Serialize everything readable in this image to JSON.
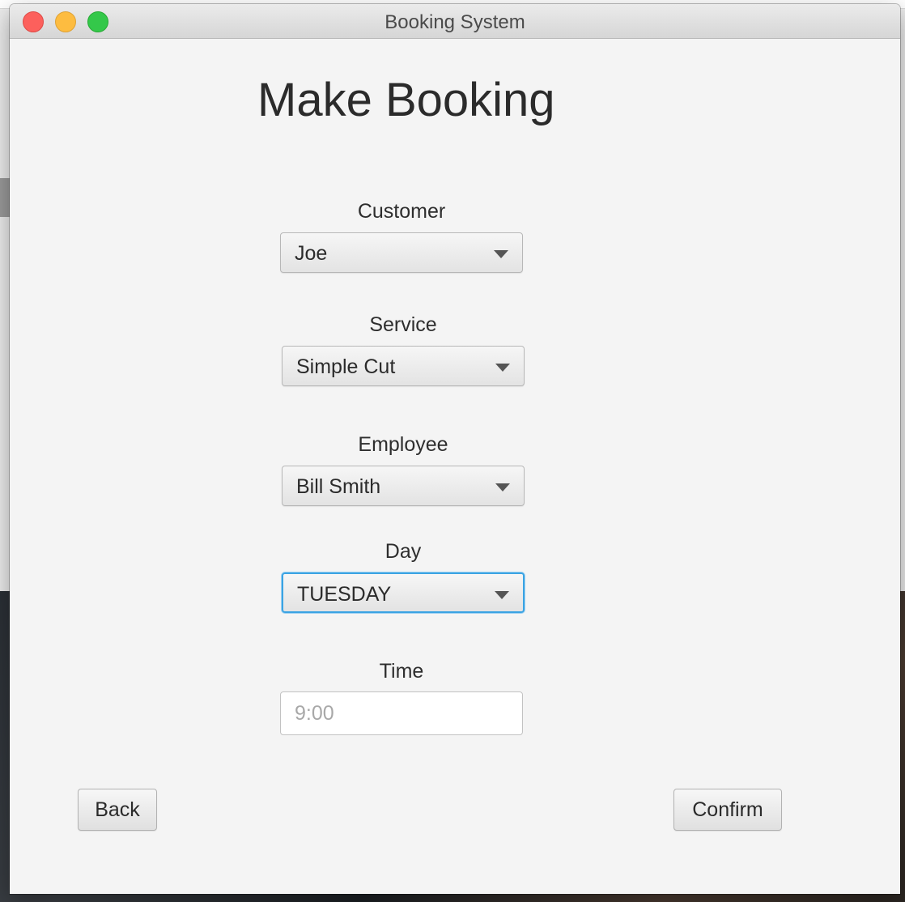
{
  "window": {
    "title": "Booking System"
  },
  "page": {
    "title": "Make Booking"
  },
  "form": {
    "customer": {
      "label": "Customer",
      "value": "Joe"
    },
    "service": {
      "label": "Service",
      "value": "Simple Cut"
    },
    "employee": {
      "label": "Employee",
      "value": "Bill Smith"
    },
    "day": {
      "label": "Day",
      "value": "TUESDAY"
    },
    "time": {
      "label": "Time",
      "placeholder": "9:00",
      "value": ""
    }
  },
  "buttons": {
    "back": "Back",
    "confirm": "Confirm"
  },
  "colors": {
    "focus_ring": "#3aa3e3",
    "window_bg": "#f4f4f4",
    "close": "#fc605c",
    "minimize": "#fdbc40",
    "maximize": "#34c84a"
  },
  "icons": {
    "combo_arrow": "chevron-down-icon"
  }
}
